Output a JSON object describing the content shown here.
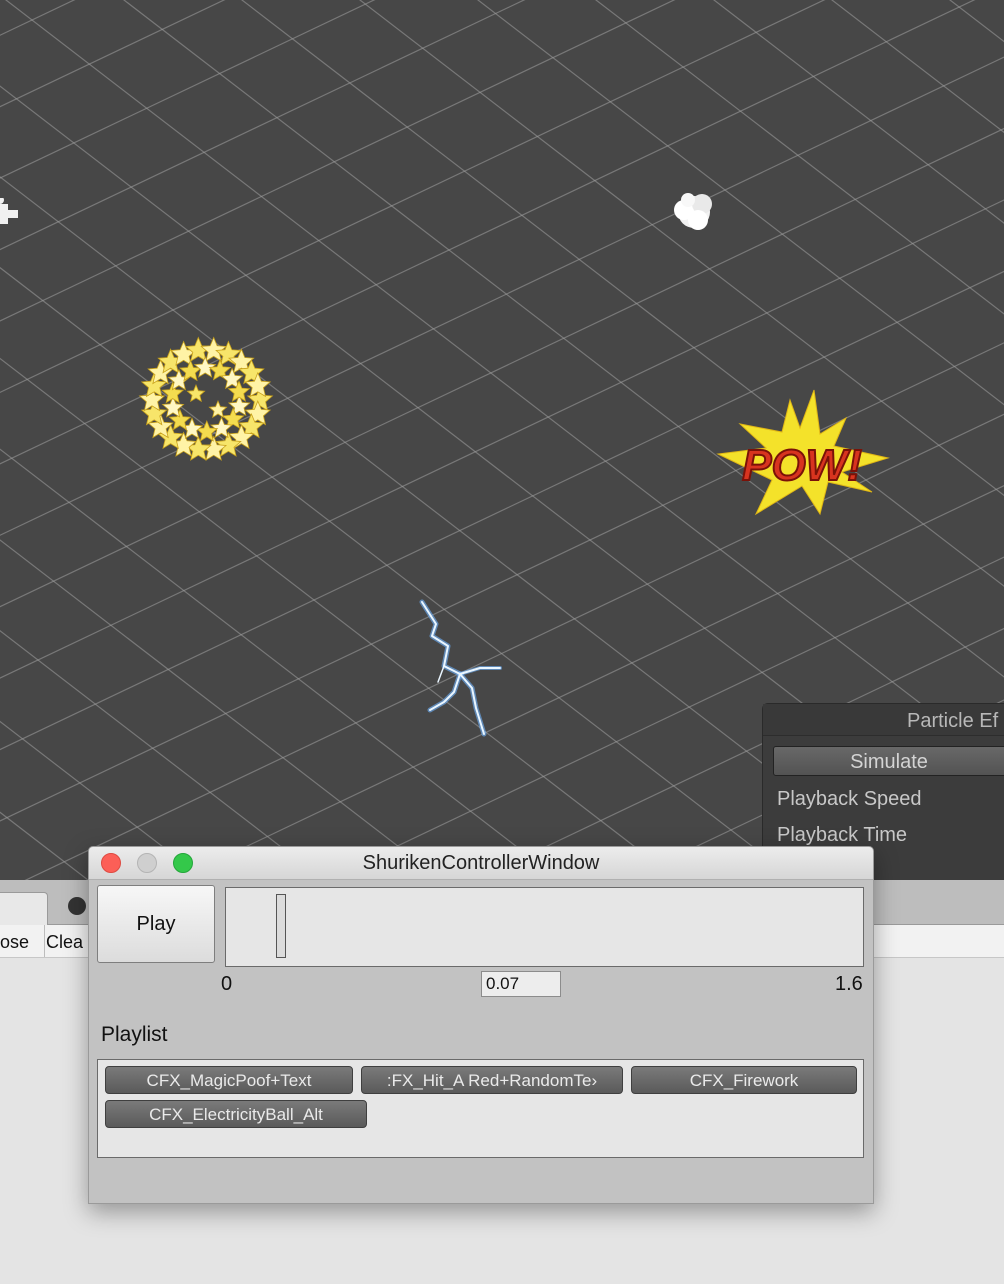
{
  "scene_view": {
    "pow_text": "POW!"
  },
  "particle_effect_panel": {
    "title": "Particle Ef",
    "simulate_label": "Simulate",
    "playback_speed_label": "Playback Speed",
    "playback_time_label": "Playback Time"
  },
  "background_editor": {
    "toolbar": [
      "ose",
      "Clea"
    ]
  },
  "shuriken_window": {
    "title": "ShurikenControllerWindow",
    "play_label": "Play",
    "timeline": {
      "min_label": "0",
      "max_label": "1.6",
      "current_value": "0.07",
      "min": 0,
      "max": 1.6,
      "position": 0.07
    },
    "playlist_label": "Playlist",
    "playlist": [
      "CFX_MagicPoof+Text",
      ":FX_Hit_A Red+RandomTe›",
      "CFX_Firework",
      "CFX_ElectricityBall_Alt"
    ]
  }
}
